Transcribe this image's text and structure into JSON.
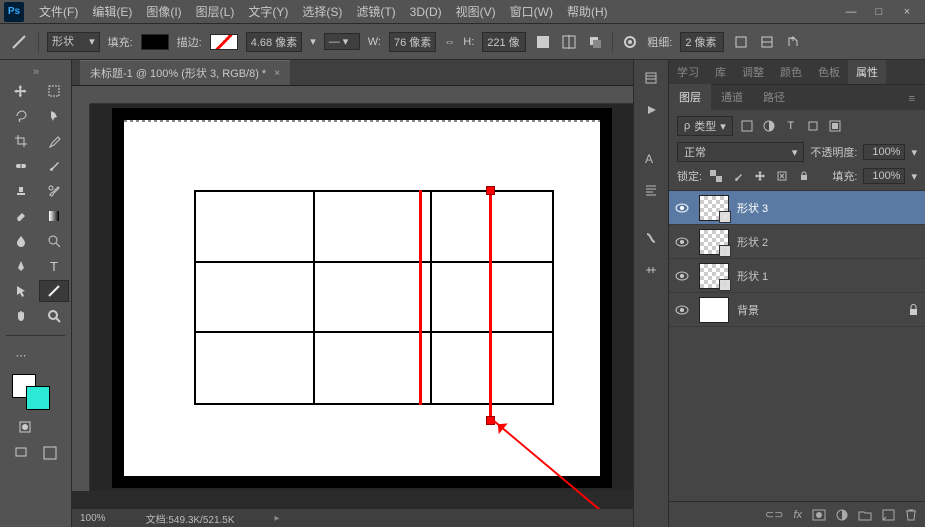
{
  "app": {
    "logo": "Ps"
  },
  "menus": [
    "文件(F)",
    "编辑(E)",
    "图像(I)",
    "图层(L)",
    "文字(Y)",
    "选择(S)",
    "滤镜(T)",
    "3D(D)",
    "视图(V)",
    "窗口(W)",
    "帮助(H)"
  ],
  "options": {
    "mode_label": "形状",
    "fill_label": "填充:",
    "stroke_label": "描边:",
    "stroke_width": "4.68 像素",
    "W": "W:",
    "W_val": "76 像素",
    "H": "H:",
    "H_val": "221 像",
    "thickness_label": "粗细:",
    "thickness_val": "2 像素"
  },
  "tab": {
    "title": "未标题-1 @ 100% (形状 3, RGB/8) *"
  },
  "status": {
    "zoom": "100%",
    "doc": "文档:549.3K/521.5K"
  },
  "panel_group1": [
    "学习",
    "库",
    "调整",
    "颜色",
    "色板",
    "属性"
  ],
  "panel_group1_active": 5,
  "panel_group2": [
    "图层",
    "通道",
    "路径"
  ],
  "panel_group2_active": 0,
  "layer_opts": {
    "filter_label": "类型",
    "blend_mode": "正常",
    "opacity_label": "不透明度:",
    "opacity_val": "100%",
    "lock_label": "锁定:",
    "fill_label": "填充:",
    "fill_val": "100%"
  },
  "layers": [
    {
      "name": "形状 3",
      "selected": true,
      "shape": true
    },
    {
      "name": "形状 2",
      "selected": false,
      "shape": true
    },
    {
      "name": "形状 1",
      "selected": false,
      "shape": true
    },
    {
      "name": "背景",
      "selected": false,
      "shape": false,
      "locked": true
    }
  ],
  "icons": {
    "search": "ρ",
    "link": "⟲"
  }
}
